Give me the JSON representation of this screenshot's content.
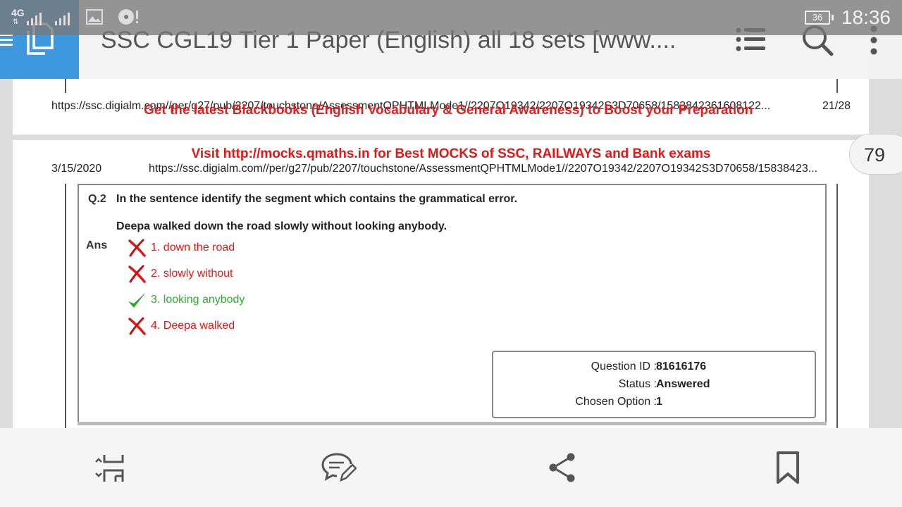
{
  "status_bar": {
    "network": "4G",
    "battery": "36",
    "time": "18:36"
  },
  "app_bar": {
    "title": "SSC CGL19 Tier 1 Paper (English) all 18 sets [www...."
  },
  "page_prev": {
    "footer_url": "https://ssc.digialm.com//per/g27/pub/2207/touchstone/AssessmentQPHTMLMode1//2207O19342/2207O19342S3D70658/1583842361608122...",
    "footer_page": "21/28",
    "promo": "Get the latest Blackbooks (English Vocabulary & General Awareness) to Boost your Preparation"
  },
  "page_current": {
    "promo": "Visit http://mocks.qmaths.in for Best MOCKS of SSC, RAILWAYS and Bank exams",
    "date": "3/15/2020",
    "header_url": "https://ssc.digialm.com//per/g27/pub/2207/touchstone/AssessmentQPHTMLMode1//2207O19342/2207O19342S3D70658/15838423...",
    "page_number_badge": "79"
  },
  "question": {
    "number": "Q.2",
    "prompt": "In the sentence identify the segment which contains the grammatical error.",
    "sentence": "Deepa walked down the road slowly without looking anybody.",
    "ans_label": "Ans",
    "options": [
      {
        "label": "1. down the road",
        "correct": false
      },
      {
        "label": "2. slowly without",
        "correct": false
      },
      {
        "label": "3. looking anybody",
        "correct": true
      },
      {
        "label": "4. Deepa walked",
        "correct": false
      }
    ]
  },
  "info": {
    "question_id_key": "Question ID :",
    "question_id_val": "81616176",
    "status_key": "Status :",
    "status_val": "Answered",
    "chosen_key": "Chosen Option :",
    "chosen_val": "1"
  },
  "colors": {
    "accent_blue": "#3f98dd",
    "wrong_red": "#e01818",
    "correct_green": "#2eaa2e"
  },
  "icons": {
    "top": [
      "menu-icon",
      "copy-icon",
      "list-icon",
      "search-icon",
      "more-vert-icon"
    ],
    "bottom": [
      "fit-page-icon",
      "comment-icon",
      "share-icon",
      "bookmark-icon"
    ]
  }
}
